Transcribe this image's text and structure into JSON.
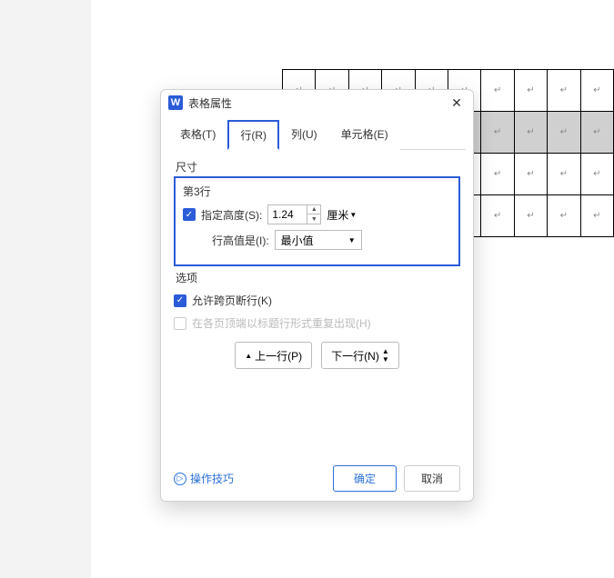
{
  "paragraph_mark": "↵",
  "dialog": {
    "icon_letter": "W",
    "title": "表格属性",
    "tabs": {
      "table": "表格(T)",
      "row": "行(R)",
      "column": "列(U)",
      "cell": "单元格(E)"
    },
    "active_tab": "row",
    "size_label": "尺寸",
    "row_name": "第3行",
    "specify_height_label": "指定高度(S):",
    "height_value": "1.24",
    "unit_label": "厘米",
    "row_height_is_label": "行高值是(I):",
    "row_height_mode": "最小值",
    "options_label": "选项",
    "allow_break_label": "允许跨页断行(K)",
    "repeat_header_label": "在各页顶端以标题行形式重复出现(H)",
    "prev_row": "上一行(P)",
    "next_row": "下一行(N)",
    "tip": "操作技巧",
    "ok": "确定",
    "cancel": "取消"
  }
}
